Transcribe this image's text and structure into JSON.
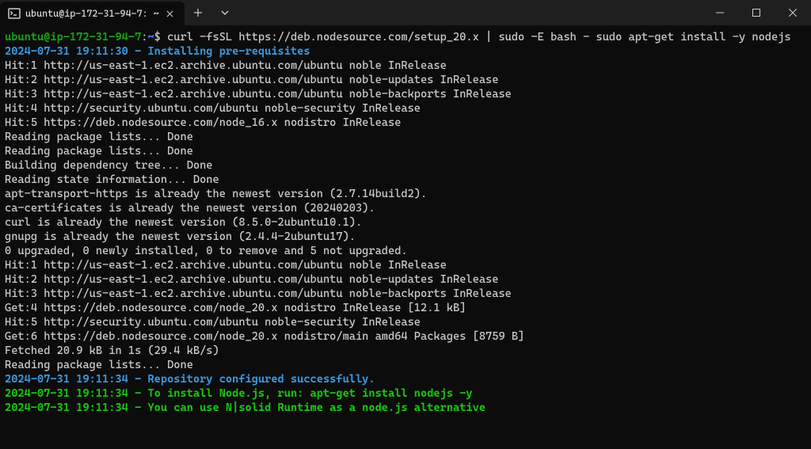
{
  "titlebar": {
    "tab_title": "ubuntu@ip-172-31-94-7: ~",
    "new_tab_label": "+",
    "dropdown_label": "⌄"
  },
  "prompt": {
    "user_host": "ubuntu@ip-172-31-94-7",
    "colon": ":",
    "path": "~",
    "symbol": "$"
  },
  "command": "curl -fsSL https://deb.nodesource.com/setup_20.x | sudo -E bash - sudo apt-get install -y nodejs",
  "lines": [
    {
      "cls": "cyan bold",
      "text": "2024-07-31 19:11:30 - Installing pre-requisites"
    },
    {
      "cls": "plain",
      "text": "Hit:1 http://us-east-1.ec2.archive.ubuntu.com/ubuntu noble InRelease"
    },
    {
      "cls": "plain",
      "text": "Hit:2 http://us-east-1.ec2.archive.ubuntu.com/ubuntu noble-updates InRelease"
    },
    {
      "cls": "plain",
      "text": "Hit:3 http://us-east-1.ec2.archive.ubuntu.com/ubuntu noble-backports InRelease"
    },
    {
      "cls": "plain",
      "text": "Hit:4 http://security.ubuntu.com/ubuntu noble-security InRelease"
    },
    {
      "cls": "plain",
      "text": "Hit:5 https://deb.nodesource.com/node_16.x nodistro InRelease"
    },
    {
      "cls": "plain",
      "text": "Reading package lists... Done"
    },
    {
      "cls": "plain",
      "text": "Reading package lists... Done"
    },
    {
      "cls": "plain",
      "text": "Building dependency tree... Done"
    },
    {
      "cls": "plain",
      "text": "Reading state information... Done"
    },
    {
      "cls": "plain",
      "text": "apt-transport-https is already the newest version (2.7.14build2)."
    },
    {
      "cls": "plain",
      "text": "ca-certificates is already the newest version (20240203)."
    },
    {
      "cls": "plain",
      "text": "curl is already the newest version (8.5.0-2ubuntu10.1)."
    },
    {
      "cls": "plain",
      "text": "gnupg is already the newest version (2.4.4-2ubuntu17)."
    },
    {
      "cls": "plain",
      "text": "0 upgraded, 0 newly installed, 0 to remove and 5 not upgraded."
    },
    {
      "cls": "plain",
      "text": "Hit:1 http://us-east-1.ec2.archive.ubuntu.com/ubuntu noble InRelease"
    },
    {
      "cls": "plain",
      "text": "Hit:2 http://us-east-1.ec2.archive.ubuntu.com/ubuntu noble-updates InRelease"
    },
    {
      "cls": "plain",
      "text": "Hit:3 http://us-east-1.ec2.archive.ubuntu.com/ubuntu noble-backports InRelease"
    },
    {
      "cls": "plain",
      "text": "Get:4 https://deb.nodesource.com/node_20.x nodistro InRelease [12.1 kB]"
    },
    {
      "cls": "plain",
      "text": "Hit:5 http://security.ubuntu.com/ubuntu noble-security InRelease"
    },
    {
      "cls": "plain",
      "text": "Get:6 https://deb.nodesource.com/node_20.x nodistro/main amd64 Packages [8759 B]"
    },
    {
      "cls": "plain",
      "text": "Fetched 20.9 kB in 1s (29.4 kB/s)"
    },
    {
      "cls": "plain",
      "text": "Reading package lists... Done"
    },
    {
      "cls": "cyan bold",
      "text": "2024-07-31 19:11:34 - Repository configured successfully."
    },
    {
      "cls": "info bold",
      "text": "2024-07-31 19:11:34 - To install Node.js, run: apt-get install nodejs -y"
    },
    {
      "cls": "info bold",
      "text": "2024-07-31 19:11:34 - You can use N|solid Runtime as a node.js alternative"
    }
  ]
}
